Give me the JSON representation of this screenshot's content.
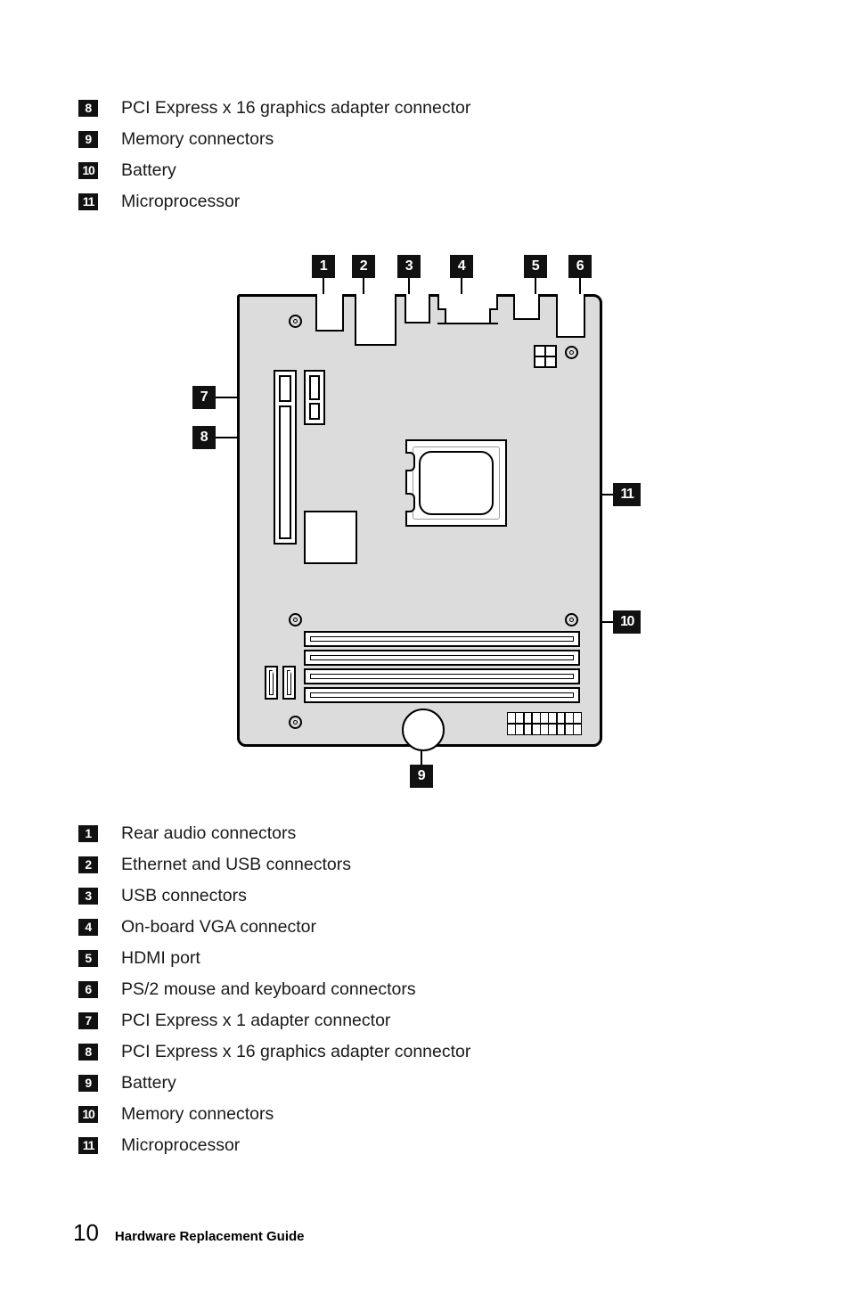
{
  "legend_top": {
    "items": [
      {
        "num": "8",
        "label": "PCI Express x 16 graphics adapter connector"
      },
      {
        "num": "9",
        "label": "Memory connectors"
      },
      {
        "num": "10",
        "label": "Battery"
      },
      {
        "num": "11",
        "label": "Microprocessor"
      }
    ]
  },
  "figure": {
    "name": "system-board-diagram",
    "board_color": "#dcdcdc",
    "callouts": [
      {
        "num": "1",
        "target": "rear-audio-connectors"
      },
      {
        "num": "2",
        "target": "ethernet-and-usb-connectors"
      },
      {
        "num": "3",
        "target": "usb-connectors"
      },
      {
        "num": "4",
        "target": "on-board-vga-connector"
      },
      {
        "num": "5",
        "target": "hdmi-port"
      },
      {
        "num": "6",
        "target": "ps2-mouse-and-keyboard-connectors"
      },
      {
        "num": "7",
        "target": "pci-express-x1-adapter-connector"
      },
      {
        "num": "8",
        "target": "pci-express-x16-graphics-adapter-connector"
      },
      {
        "num": "9",
        "target": "battery"
      },
      {
        "num": "10",
        "target": "memory-connectors"
      },
      {
        "num": "11",
        "target": "microprocessor"
      }
    ]
  },
  "legend_main": {
    "items": [
      {
        "num": "1",
        "label": "Rear audio connectors"
      },
      {
        "num": "2",
        "label": "Ethernet and USB connectors"
      },
      {
        "num": "3",
        "label": "USB connectors"
      },
      {
        "num": "4",
        "label": "On-board VGA connector"
      },
      {
        "num": "5",
        "label": "HDMI port"
      },
      {
        "num": "6",
        "label": "PS/2 mouse and keyboard connectors"
      },
      {
        "num": "7",
        "label": "PCI Express x 1 adapter connector"
      },
      {
        "num": "8",
        "label": "PCI Express x 16 graphics adapter connector"
      },
      {
        "num": "9",
        "label": "Battery"
      },
      {
        "num": "10",
        "label": "Memory connectors"
      },
      {
        "num": "11",
        "label": "Microprocessor"
      }
    ]
  },
  "footer": {
    "page_number": "10",
    "title": "Hardware Replacement Guide"
  }
}
